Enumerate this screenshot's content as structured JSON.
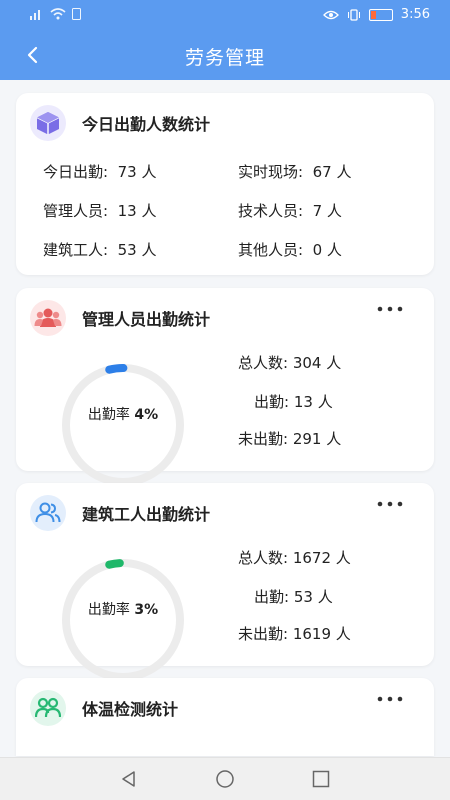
{
  "status_bar": {
    "time": "3:56"
  },
  "app_bar": {
    "title": "劳务管理"
  },
  "today_card": {
    "title": "今日出勤人数统计",
    "items": [
      {
        "label": "今日出勤:",
        "value": "73 人"
      },
      {
        "label": "实时现场:",
        "value": "67 人"
      },
      {
        "label": "管理人员:",
        "value": "13 人"
      },
      {
        "label": "技术人员:",
        "value": "7 人"
      },
      {
        "label": "建筑工人:",
        "value": "53 人"
      },
      {
        "label": "其他人员:",
        "value": "0 人"
      }
    ]
  },
  "manager_card": {
    "title": "管理人员出勤统计",
    "rate_label": "出勤率",
    "rate": "4%",
    "rate_value": 0.04,
    "ring_color": "#2d7fe8",
    "total_label": "总人数:",
    "total": "304 人",
    "present_label": "出勤:",
    "present": "13 人",
    "absent_label": "未出勤:",
    "absent": "291 人"
  },
  "worker_card": {
    "title": "建筑工人出勤统计",
    "rate_label": "出勤率",
    "rate": "3%",
    "rate_value": 0.03,
    "ring_color": "#1fb86a",
    "total_label": "总人数:",
    "total": "1672 人",
    "present_label": "出勤:",
    "present": "53 人",
    "absent_label": "未出勤:",
    "absent": "1619 人"
  },
  "temp_card": {
    "title": "体温检测统计"
  },
  "colors": {
    "primary": "#5b9bf0",
    "manager_icon": "#e45a5a",
    "worker_icon": "#3f8fe6",
    "temp_icon": "#27b873"
  }
}
